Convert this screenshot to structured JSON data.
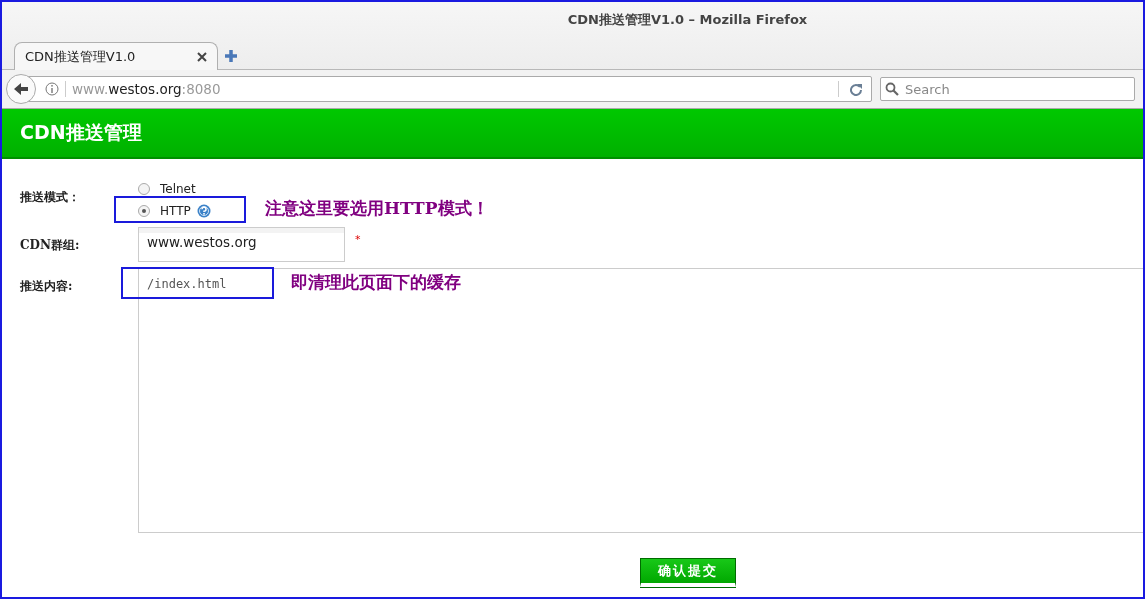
{
  "window": {
    "title": "CDN推送管理V1.0 – Mozilla Firefox"
  },
  "tabs": [
    {
      "label": "CDN推送管理V1.0",
      "selected": true
    }
  ],
  "address_bar": {
    "prefix": "www.",
    "domain": "westos.org",
    "port": ":8080"
  },
  "search": {
    "placeholder": "Search"
  },
  "header": {
    "title": "CDN推送管理"
  },
  "form": {
    "mode_label": "推送模式：",
    "modes": [
      {
        "label": "Telnet",
        "selected": false,
        "help": false
      },
      {
        "label": "HTTP",
        "selected": true,
        "help": true
      }
    ],
    "group_label": "CDN群组:",
    "group_value": "www.westos.org",
    "required_mark": "*",
    "content_label": "推送内容:",
    "content_value": "/index.html",
    "submit": "确认提交"
  },
  "annotations": [
    {
      "note": "注意这里要选用HTTP模式！"
    },
    {
      "note": "即清理此页面下的缓存"
    }
  ]
}
